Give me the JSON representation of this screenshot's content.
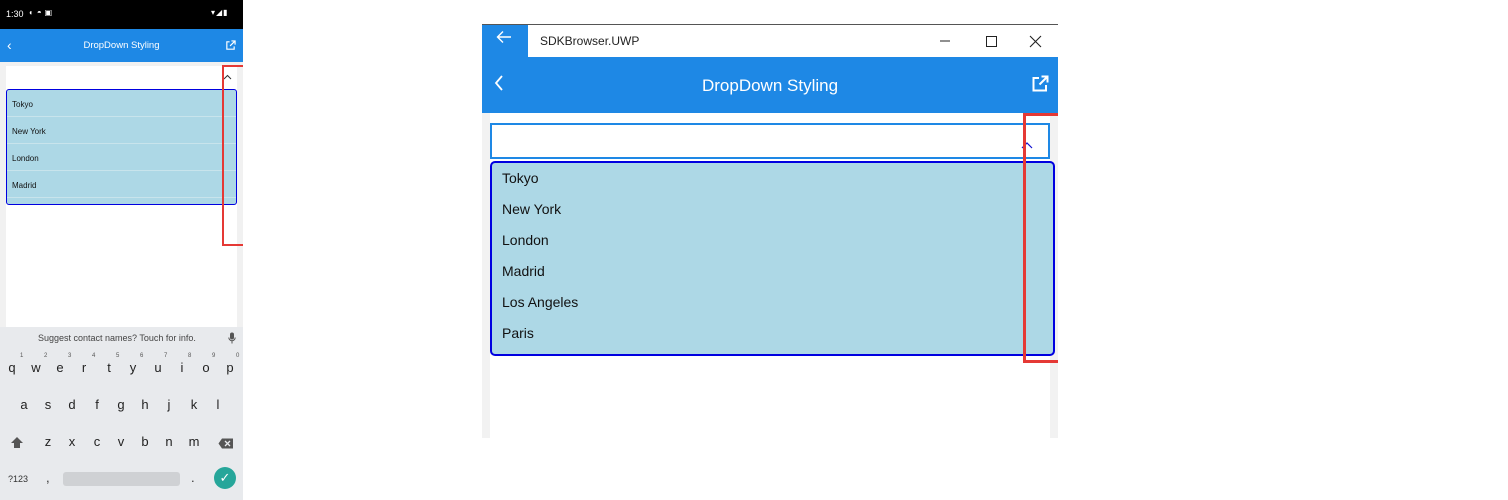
{
  "android": {
    "status_bar": {
      "time": "1:30"
    },
    "app_bar": {
      "title": "DropDown Styling"
    },
    "dropdown": {
      "items": [
        "Tokyo",
        "New York",
        "London",
        "Madrid"
      ]
    },
    "keyboard": {
      "suggestion": "Suggest contact names? Touch for info.",
      "row1": [
        "q",
        "w",
        "e",
        "r",
        "t",
        "y",
        "u",
        "i",
        "o",
        "p"
      ],
      "row1_hints": [
        "1",
        "2",
        "3",
        "4",
        "5",
        "6",
        "7",
        "8",
        "9",
        "0"
      ],
      "row2": [
        "a",
        "s",
        "d",
        "f",
        "g",
        "h",
        "j",
        "k",
        "l"
      ],
      "row3": [
        "z",
        "x",
        "c",
        "v",
        "b",
        "n",
        "m"
      ],
      "symbols_label": "?123",
      "comma": ",",
      "period": "."
    }
  },
  "uwp": {
    "window_title": "SDKBrowser.UWP",
    "app_bar": {
      "title": "DropDown Styling"
    },
    "dropdown": {
      "items": [
        "Tokyo",
        "New York",
        "London",
        "Madrid",
        "Los Angeles",
        "Paris"
      ]
    }
  },
  "colors": {
    "accent": "#1e88e5",
    "dropdown_background": "#add8e6",
    "dropdown_border": "#0000e0",
    "highlight": "#e53935"
  }
}
